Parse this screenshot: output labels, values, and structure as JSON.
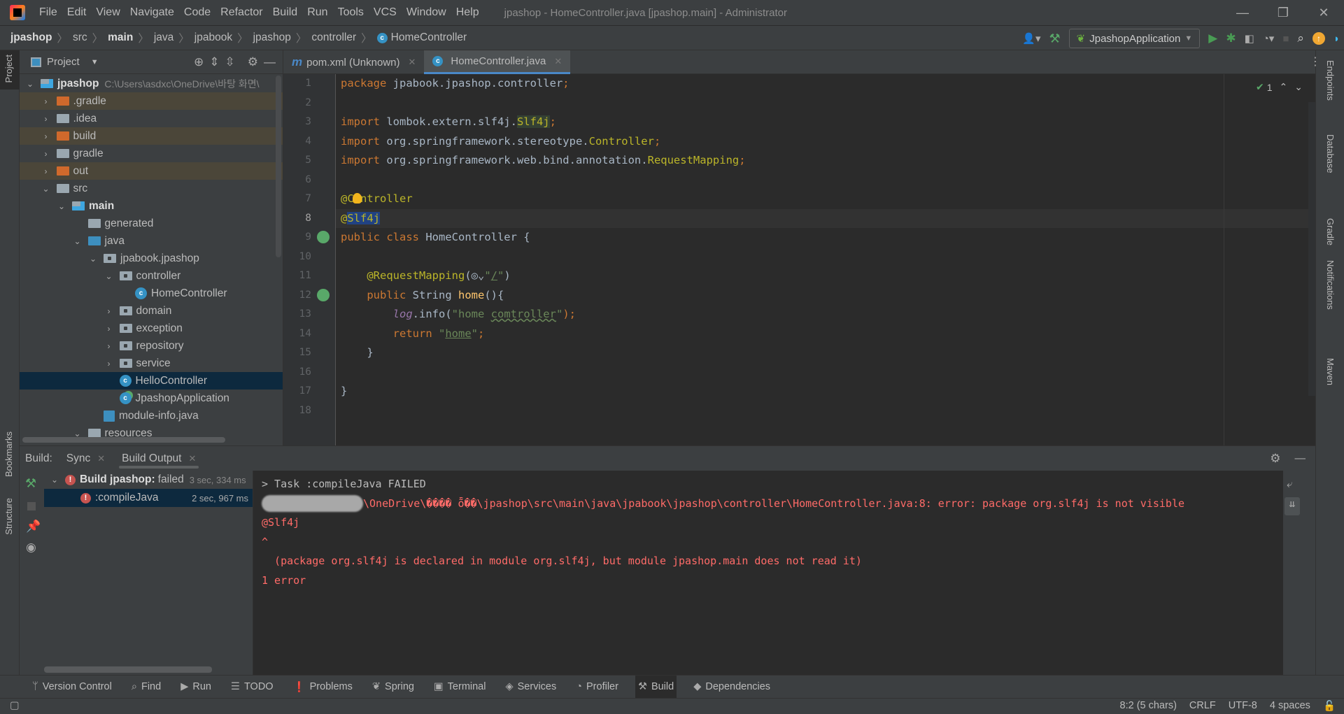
{
  "window": {
    "title": "jpashop - HomeController.java [jpashop.main] - Administrator"
  },
  "menu": [
    "File",
    "Edit",
    "View",
    "Navigate",
    "Code",
    "Refactor",
    "Build",
    "Run",
    "Tools",
    "VCS",
    "Window",
    "Help"
  ],
  "breadcrumb": [
    {
      "label": "jpashop",
      "bold": true
    },
    {
      "label": "src"
    },
    {
      "label": "main",
      "bold": true
    },
    {
      "label": "java"
    },
    {
      "label": "jpabook"
    },
    {
      "label": "jpashop"
    },
    {
      "label": "controller"
    },
    {
      "label": "HomeController",
      "icon": "class-icon"
    }
  ],
  "toolbar": {
    "run_config": "JpashopApplication"
  },
  "left_stripe": {
    "project": "Project",
    "bookmarks": "Bookmarks",
    "structure": "Structure"
  },
  "right_stripe": [
    "Endpoints",
    "Database",
    "Gradle",
    "Notifications",
    "Maven"
  ],
  "project": {
    "title": "Project",
    "tree": [
      {
        "label": "jpashop",
        "depth": 0,
        "arrow": "down",
        "icon": "module",
        "bold": true,
        "path": "C:\\Users\\asdxc\\OneDrive\\바탕 화면\\"
      },
      {
        "label": ".gradle",
        "depth": 1,
        "arrow": "right",
        "icon": "orange",
        "excluded": true
      },
      {
        "label": ".idea",
        "depth": 1,
        "arrow": "right",
        "icon": "folder"
      },
      {
        "label": "build",
        "depth": 1,
        "arrow": "right",
        "icon": "orange",
        "excluded": true
      },
      {
        "label": "gradle",
        "depth": 1,
        "arrow": "right",
        "icon": "folder"
      },
      {
        "label": "out",
        "depth": 1,
        "arrow": "right",
        "icon": "orange",
        "excluded": true
      },
      {
        "label": "src",
        "depth": 1,
        "arrow": "down",
        "icon": "folder"
      },
      {
        "label": "main",
        "depth": 2,
        "arrow": "down",
        "icon": "module",
        "bold": true
      },
      {
        "label": "generated",
        "depth": 3,
        "arrow": "",
        "icon": "folder"
      },
      {
        "label": "java",
        "depth": 3,
        "arrow": "down",
        "icon": "blue"
      },
      {
        "label": "jpabook.jpashop",
        "depth": 4,
        "arrow": "down",
        "icon": "pkg"
      },
      {
        "label": "controller",
        "depth": 5,
        "arrow": "down",
        "icon": "pkg"
      },
      {
        "label": "HomeController",
        "depth": 6,
        "arrow": "",
        "icon": "class"
      },
      {
        "label": "domain",
        "depth": 5,
        "arrow": "right",
        "icon": "pkg"
      },
      {
        "label": "exception",
        "depth": 5,
        "arrow": "right",
        "icon": "pkg"
      },
      {
        "label": "repository",
        "depth": 5,
        "arrow": "right",
        "icon": "pkg"
      },
      {
        "label": "service",
        "depth": 5,
        "arrow": "right",
        "icon": "pkg"
      },
      {
        "label": "HelloController",
        "depth": 5,
        "arrow": "",
        "icon": "class",
        "selected": true
      },
      {
        "label": "JpashopApplication",
        "depth": 5,
        "arrow": "",
        "icon": "spring-class"
      },
      {
        "label": "module-info.java",
        "depth": 4,
        "arrow": "",
        "icon": "java-file"
      },
      {
        "label": "resources",
        "depth": 3,
        "arrow": "down",
        "icon": "resources"
      }
    ]
  },
  "editor": {
    "tabs": [
      {
        "label": "pom.xml (Unknown)",
        "icon": "maven-icon",
        "active": false
      },
      {
        "label": "HomeController.java",
        "icon": "class-icon",
        "active": true
      }
    ],
    "inspection_count": "1",
    "current_line": 8,
    "lines": [
      [
        {
          "t": "package ",
          "c": "kw"
        },
        {
          "t": "jpabook.jpashop.controller",
          "c": "plain"
        },
        {
          "t": ";",
          "c": "kw"
        }
      ],
      [],
      [
        {
          "t": "import ",
          "c": "kw"
        },
        {
          "t": "lombok.extern.slf4j.",
          "c": "plain"
        },
        {
          "t": "Slf4j",
          "c": "cls hl-use"
        },
        {
          "t": ";",
          "c": "kw"
        }
      ],
      [
        {
          "t": "import ",
          "c": "kw"
        },
        {
          "t": "org.springframework.stereotype.",
          "c": "plain"
        },
        {
          "t": "Controller",
          "c": "cls"
        },
        {
          "t": ";",
          "c": "kw"
        }
      ],
      [
        {
          "t": "import ",
          "c": "kw"
        },
        {
          "t": "org.springframework.web.bind.annotation.",
          "c": "plain"
        },
        {
          "t": "RequestMapping",
          "c": "cls"
        },
        {
          "t": ";",
          "c": "kw"
        }
      ],
      [],
      [
        {
          "t": "@Controller",
          "c": "ann"
        }
      ],
      [
        {
          "t": "@",
          "c": "ann"
        },
        {
          "t": "Slf4j",
          "c": "ann hl-sel"
        }
      ],
      [
        {
          "t": "public class ",
          "c": "kw"
        },
        {
          "t": "HomeController {",
          "c": "plain"
        }
      ],
      [],
      [
        {
          "t": "    @RequestMapping",
          "c": "ann"
        },
        {
          "t": "(",
          "c": "plain"
        },
        {
          "t": "◎⌄",
          "c": "plain"
        },
        {
          "t": "\"",
          "c": "str"
        },
        {
          "t": "/",
          "c": "str ul"
        },
        {
          "t": "\"",
          "c": "str"
        },
        {
          "t": ")",
          "c": "plain"
        }
      ],
      [
        {
          "t": "    public ",
          "c": "kw"
        },
        {
          "t": "String ",
          "c": "plain"
        },
        {
          "t": "home",
          "c": "fn"
        },
        {
          "t": "(){",
          "c": "plain"
        }
      ],
      [
        {
          "t": "        ",
          "c": "plain"
        },
        {
          "t": "log",
          "c": "fld"
        },
        {
          "t": ".info(",
          "c": "plain"
        },
        {
          "t": "\"home ",
          "c": "str"
        },
        {
          "t": "comtroller",
          "c": "str squig"
        },
        {
          "t": "\"",
          "c": "str"
        },
        {
          "t": ");",
          "c": "kw"
        }
      ],
      [
        {
          "t": "        return ",
          "c": "kw"
        },
        {
          "t": "\"",
          "c": "str"
        },
        {
          "t": "home",
          "c": "str ul"
        },
        {
          "t": "\"",
          "c": "str"
        },
        {
          "t": ";",
          "c": "kw"
        }
      ],
      [
        {
          "t": "    }",
          "c": "plain"
        }
      ],
      [],
      [
        {
          "t": "}",
          "c": "plain"
        }
      ],
      []
    ]
  },
  "build": {
    "label": "Build:",
    "tabs": [
      {
        "label": "Sync"
      },
      {
        "label": "Build Output",
        "active": true
      }
    ],
    "tree": [
      {
        "label": "Build jpashop:",
        "status": "failed",
        "time": "3 sec, 334 ms"
      },
      {
        "label": ":compileJava",
        "time": "2 sec, 967 ms"
      }
    ],
    "console": [
      {
        "text": "> Task :compileJava FAILED",
        "kind": "normal"
      },
      {
        "text": "\\OneDrive\\���� ȭ��\\jpashop\\src\\main\\java\\jpabook\\jpashop\\controller\\HomeController.java:8: error: package org.slf4j is not visible",
        "kind": "error",
        "redacted_prefix": true
      },
      {
        "text": "@Slf4j",
        "kind": "error"
      },
      {
        "text": "^",
        "kind": "error"
      },
      {
        "text": "  (package org.slf4j is declared in module org.slf4j, but module jpashop.main does not read it)",
        "kind": "error"
      },
      {
        "text": "1 error",
        "kind": "error"
      }
    ]
  },
  "bottom_tools": [
    {
      "label": "Version Control",
      "icon": "vcs-icon"
    },
    {
      "label": "Find",
      "icon": "search-icon"
    },
    {
      "label": "Run",
      "icon": "run-icon"
    },
    {
      "label": "TODO",
      "icon": "list-icon"
    },
    {
      "label": "Problems",
      "icon": "problems-icon"
    },
    {
      "label": "Spring",
      "icon": "spring-icon"
    },
    {
      "label": "Terminal",
      "icon": "terminal-icon"
    },
    {
      "label": "Services",
      "icon": "services-icon"
    },
    {
      "label": "Profiler",
      "icon": "profiler-icon"
    },
    {
      "label": "Build",
      "icon": "hammer-icon",
      "active": true
    },
    {
      "label": "Dependencies",
      "icon": "dependencies-icon"
    }
  ],
  "status": {
    "position": "8:2 (5 chars)",
    "line_sep": "CRLF",
    "encoding": "UTF-8",
    "indent": "4 spaces"
  },
  "colors": {
    "keyword": "#cc7832",
    "annotation": "#bbb529",
    "string": "#6a8759",
    "error": "#ff6b68",
    "selection": "#214283",
    "accent": "#4a88c7"
  }
}
